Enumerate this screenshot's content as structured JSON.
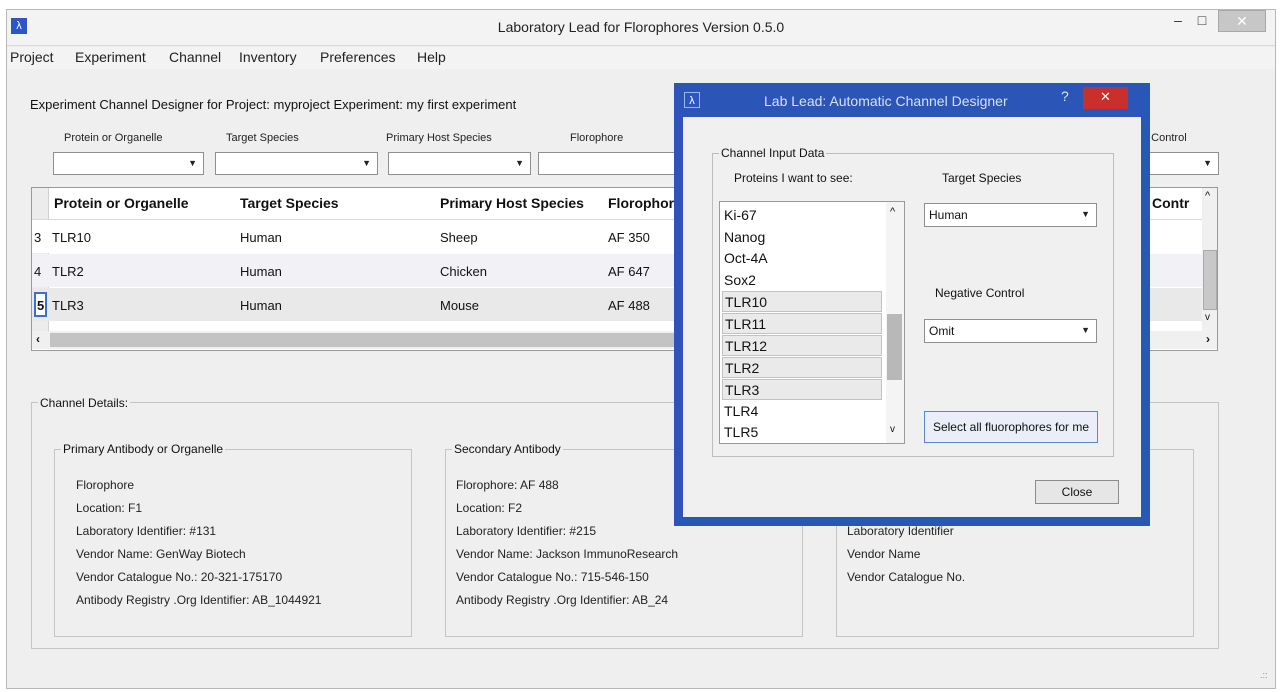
{
  "window": {
    "title": "Laboratory Lead for Florophores  Version 0.5.0",
    "app_icon_glyph": "λ",
    "minimize_glyph": "–",
    "maximize_glyph": "□",
    "close_glyph": "✕"
  },
  "menu": [
    "Project",
    "Experiment",
    "Channel",
    "Inventory",
    "Preferences",
    "Help"
  ],
  "designer": {
    "heading": "Experiment Channel  Designer for Project:  myproject  Experiment:  my first experiment",
    "filter_labels": [
      "Protein or Organelle",
      "Target Species",
      "Primary Host Species",
      "Florophore",
      "e Control"
    ]
  },
  "table": {
    "columns": [
      "Protein or Organelle",
      "Target Species",
      "Primary Host Species",
      "Florophore",
      "Contr"
    ],
    "rows": [
      {
        "num": "3",
        "protein": "TLR10",
        "species": "Human",
        "host": "Sheep",
        "florophore": "AF 350"
      },
      {
        "num": "4",
        "protein": "TLR2",
        "species": "Human",
        "host": "Chicken",
        "florophore": "AF 647"
      },
      {
        "num": "5",
        "protein": "TLR3",
        "species": "Human",
        "host": "Mouse",
        "florophore": "AF 488"
      }
    ]
  },
  "details": {
    "label": "Channel Details:",
    "primary": {
      "label": "Primary Antibody or Organelle",
      "lines": [
        "Florophore",
        "Location: F1",
        "Laboratory Identifier: #131",
        "Vendor Name: GenWay Biotech",
        "Vendor Catalogue No.: 20-321-175170",
        "Antibody Registry .Org Identifier: AB_1044921"
      ]
    },
    "secondary": {
      "label": "Secondary Antibody",
      "lines": [
        "Florophore: AF 488",
        "Location: F2",
        "Laboratory Identifier: #215",
        "Vendor Name: Jackson ImmunoResearch",
        "Vendor Catalogue No.: 715-546-150",
        "Antibody Registry .Org Identifier: AB_24"
      ]
    },
    "third": {
      "lines": [
        "Laboratory Identifier",
        "Vendor Name",
        "Vendor Catalogue No."
      ]
    }
  },
  "dialog": {
    "title": "Lab Lead:  Automatic Channel Designer",
    "help_glyph": "?",
    "group_label": "Channel Input Data",
    "proteins_label": "Proteins I want to see:",
    "target_species_label": "Target Species",
    "target_species_value": "Human",
    "negative_control_label": "Negative Control",
    "negative_control_value": "Omit",
    "select_all_label": "Select all fluorophores for me",
    "close_label": "Close",
    "proteins": [
      "Ki-67",
      "Nanog",
      "Oct-4A",
      "Sox2",
      "TLR10",
      "TLR11",
      "TLR12",
      "TLR2",
      "TLR3",
      "TLR4",
      "TLR5"
    ],
    "selected": [
      "TLR10",
      "TLR11",
      "TLR12",
      "TLR2",
      "TLR3"
    ]
  }
}
